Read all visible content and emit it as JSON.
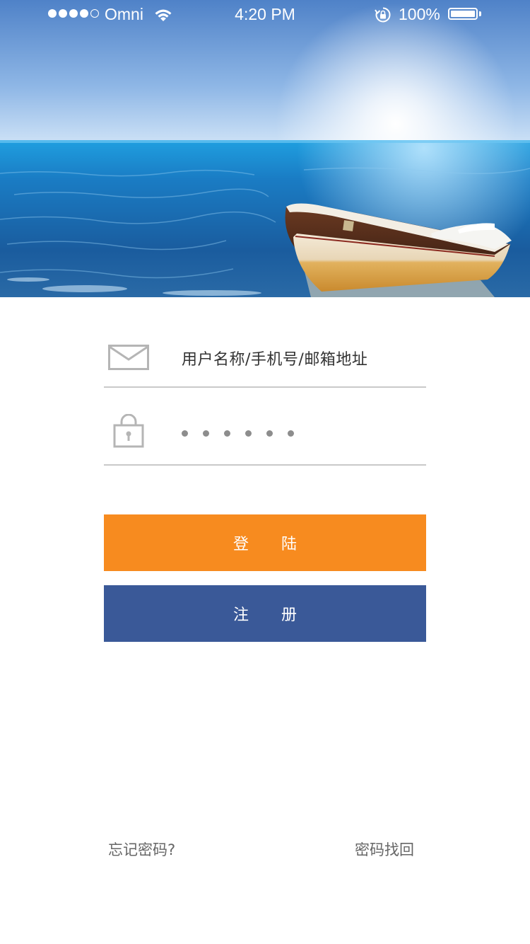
{
  "status_bar": {
    "carrier": "Omni",
    "time": "4:20 PM",
    "battery": "100%",
    "signal_bars_filled": 4,
    "signal_bars_total": 5
  },
  "login_form": {
    "username_placeholder": "用户名称/手机号/邮箱地址",
    "password_masked": "••••••",
    "login_label": "登陆",
    "register_label": "注册"
  },
  "footer": {
    "forgot_password": "忘记密码?",
    "recover_password": "密码找回"
  },
  "colors": {
    "login_button": "#f78b1f",
    "register_button": "#3a5998",
    "divider": "#c9c9c9",
    "icon": "#b5b5b5"
  },
  "icons": {
    "username": "envelope-icon",
    "password": "lock-icon"
  }
}
